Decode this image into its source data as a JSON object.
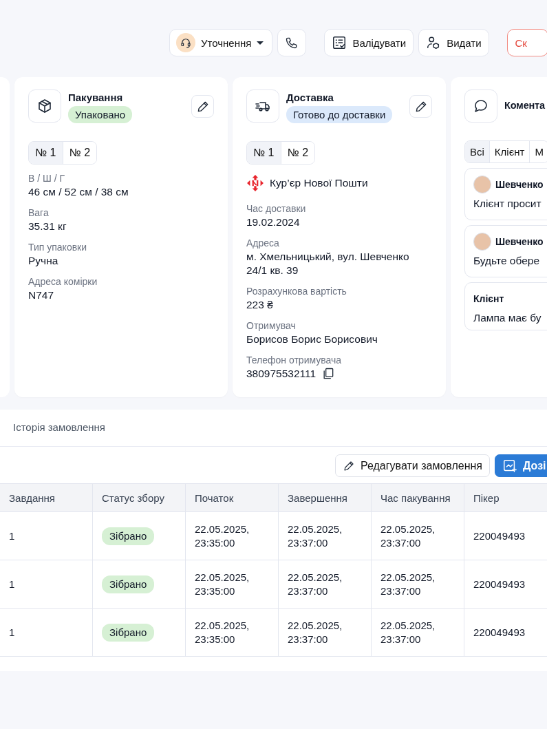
{
  "toolbar": [
    {
      "kind": "dropdown",
      "label": "Уточнення"
    },
    {
      "kind": "phone"
    },
    {
      "kind": "divider"
    },
    {
      "kind": "validate",
      "label": "Валідувати"
    },
    {
      "kind": "issue",
      "label": "Видати"
    },
    {
      "kind": "divider"
    },
    {
      "kind": "danger",
      "label": "Ск"
    }
  ],
  "packing": {
    "title": "Пакування",
    "status": {
      "label": "Упаковано",
      "color": "#d6f0d4"
    },
    "tabs": [
      {
        "label": "№ 1",
        "selected": true
      },
      {
        "label": "№ 2",
        "selected": false
      }
    ],
    "fields": [
      {
        "label": "В / Ш / Г",
        "value": "46 см / 52 см / 38 см"
      },
      {
        "label": "Вага",
        "value": "35.31 кг"
      },
      {
        "label": "Тип упаковки",
        "value": "Ручна"
      },
      {
        "label": "Адреса комірки",
        "value": "N747"
      }
    ]
  },
  "delivery": {
    "title": "Доставка",
    "status": {
      "label": "Готово до доставки",
      "color": "#dbe9fb"
    },
    "tabs": [
      {
        "label": "№ 1",
        "selected": true
      },
      {
        "label": "№ 2",
        "selected": false
      }
    ],
    "carrier": "Кур’єр Нової Пошти",
    "fields": [
      {
        "kind": "text",
        "label": "Час доставки",
        "value": "19.02.2024"
      },
      {
        "kind": "text",
        "label": "Адреса",
        "value": "м. Хмельницький, вул. Шевченко 24/1 кв. 39"
      },
      {
        "kind": "text",
        "label": "Розрахункова вартість",
        "value": "223 ₴"
      },
      {
        "kind": "text",
        "label": "Отримувач",
        "value": "Борисов Борис Борисович"
      },
      {
        "kind": "copy",
        "label": "Телефон отримувача",
        "value": "380975532111"
      }
    ]
  },
  "comments": {
    "title": "Комента",
    "tabs": [
      {
        "label": "Всі",
        "selected": true
      },
      {
        "label": "Клієнт",
        "selected": false
      },
      {
        "label": "М",
        "selected": false
      }
    ],
    "items": [
      {
        "kind": "staff",
        "author": "Шевченко",
        "text": "Клієнт просит"
      },
      {
        "kind": "staff",
        "author": "Шевченко",
        "text": "Будьте обере"
      },
      {
        "kind": "client",
        "author": "Клієнт",
        "text": "Лампа має бу"
      }
    ]
  },
  "history": {
    "title": "Історія замовлення",
    "actions": [
      {
        "kind": "outline",
        "label": "Редагувати замовлення"
      },
      {
        "kind": "primary",
        "label": "Дозі"
      }
    ],
    "table": {
      "columns": [
        "Завдання",
        "Статус збору",
        "Початок",
        "Завершення",
        "Час пакування",
        "Пікер"
      ],
      "rows": [
        {
          "task": "1",
          "status": {
            "label": "Зібрано",
            "color": "#d6f0d4"
          },
          "start": "22.05.2025, 23:35:00",
          "end": "22.05.2025, 23:37:00",
          "packed": "22.05.2025, 23:37:00",
          "picker": "220049493"
        },
        {
          "task": "1",
          "status": {
            "label": "Зібрано",
            "color": "#d6f0d4"
          },
          "start": "22.05.2025, 23:35:00",
          "end": "22.05.2025, 23:37:00",
          "packed": "22.05.2025, 23:37:00",
          "picker": "220049493"
        },
        {
          "task": "1",
          "status": {
            "label": "Зібрано",
            "color": "#d6f0d4"
          },
          "start": "22.05.2025, 23:35:00",
          "end": "22.05.2025, 23:37:00",
          "packed": "22.05.2025, 23:37:00",
          "picker": "220049493"
        }
      ]
    }
  }
}
